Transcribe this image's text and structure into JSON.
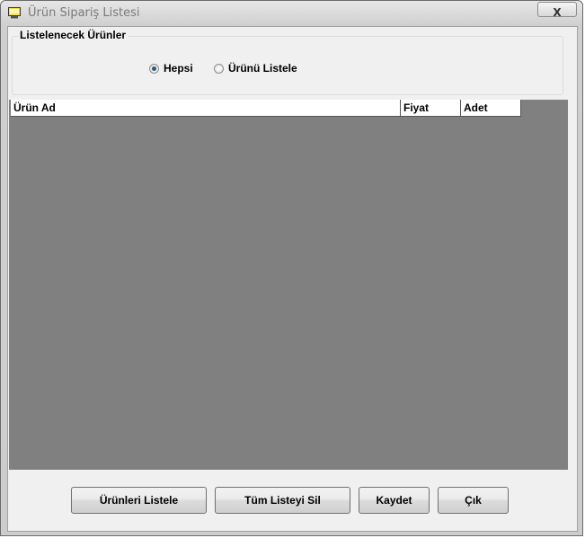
{
  "window": {
    "title": "Ürün Sipariş Listesi",
    "close_label": "X"
  },
  "filter_group": {
    "title": "Listelenecek Ürünler",
    "options": [
      {
        "label": "Hepsi",
        "checked": true
      },
      {
        "label": "Ürünü Listele",
        "checked": false
      }
    ]
  },
  "table": {
    "columns": [
      "Ürün Ad",
      "Fiyat",
      "Adet"
    ],
    "rows": []
  },
  "buttons": {
    "list_products": "Ürünleri Listele",
    "clear_list": "Tüm Listeyi Sil",
    "save": "Kaydet",
    "exit": "Çık"
  }
}
